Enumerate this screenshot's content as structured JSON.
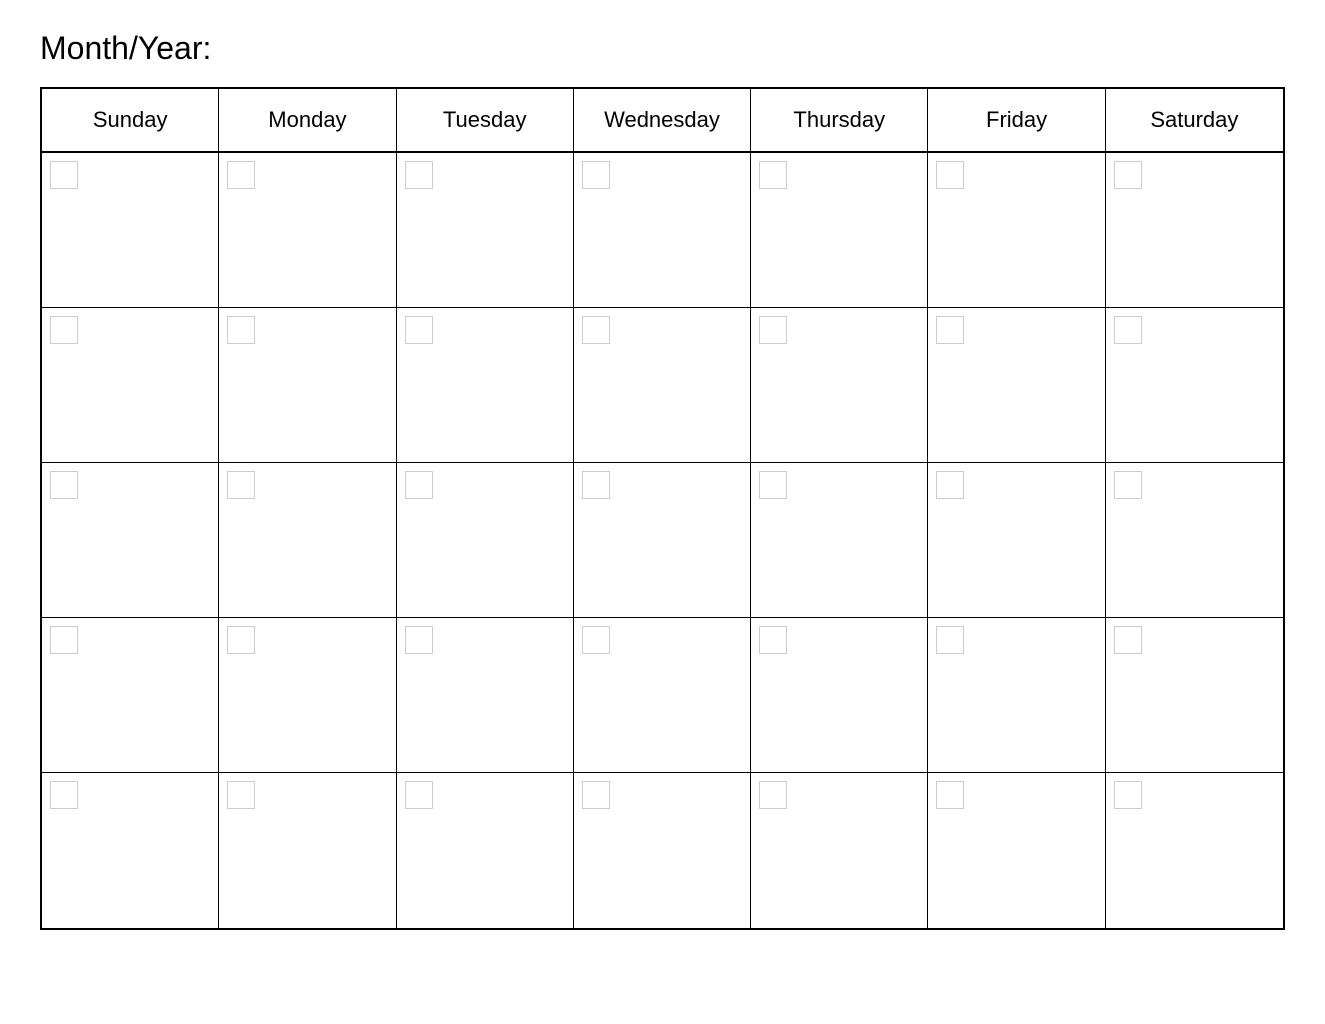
{
  "header": {
    "title": "Month/Year:"
  },
  "calendar": {
    "days": [
      {
        "label": "Sunday"
      },
      {
        "label": "Monday"
      },
      {
        "label": "Tuesday"
      },
      {
        "label": "Wednesday"
      },
      {
        "label": "Thursday"
      },
      {
        "label": "Friday"
      },
      {
        "label": "Saturday"
      }
    ],
    "rows": 5
  }
}
